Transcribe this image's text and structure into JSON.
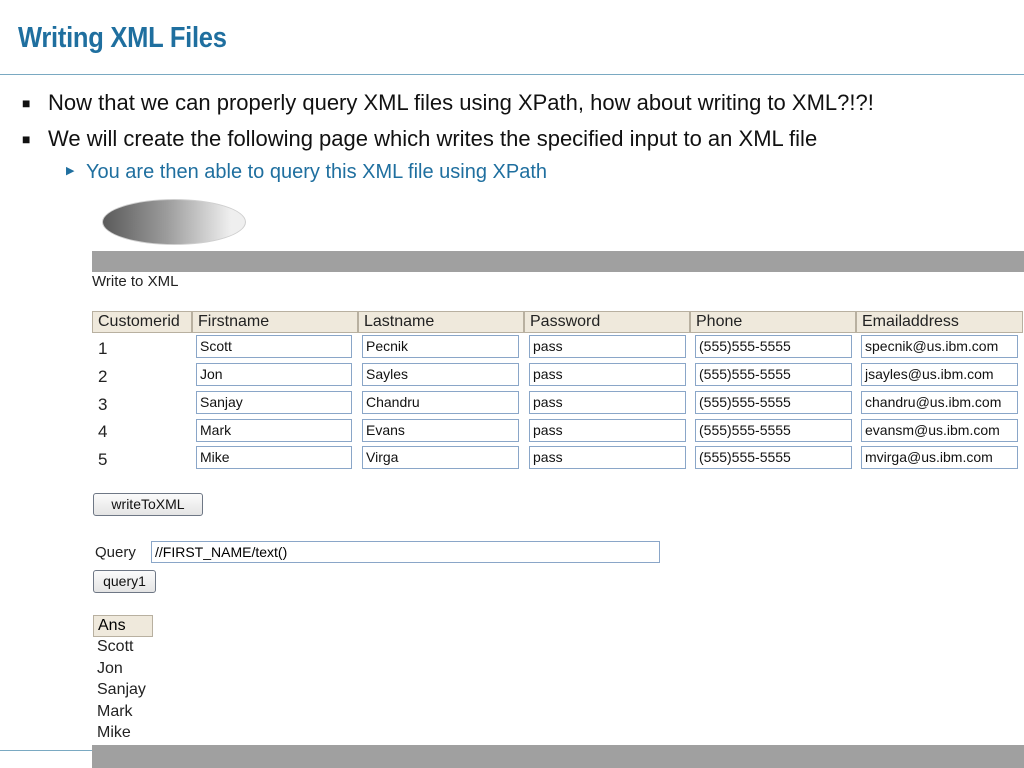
{
  "slide": {
    "title": "Writing XML Files",
    "bullets": [
      "Now that we can properly query XML files using XPath, how about writing to XML?!?!",
      "We will create the following page which writes the specified input to an XML file"
    ],
    "sub_bullet": "You are then able to query this XML file using XPath"
  },
  "app": {
    "page_label": "Write to XML",
    "columns": [
      "Customerid",
      "Firstname",
      "Lastname",
      "Password",
      "Phone",
      "Emailaddress"
    ],
    "rows": [
      {
        "id": "1",
        "first": "Scott",
        "last": "Pecnik",
        "password": "pass",
        "phone": "(555)555-5555",
        "email": "specnik@us.ibm.com"
      },
      {
        "id": "2",
        "first": "Jon",
        "last": "Sayles",
        "password": "pass",
        "phone": "(555)555-5555",
        "email": "jsayles@us.ibm.com"
      },
      {
        "id": "3",
        "first": "Sanjay",
        "last": "Chandru",
        "password": "pass",
        "phone": "(555)555-5555",
        "email": "chandru@us.ibm.com"
      },
      {
        "id": "4",
        "first": "Mark",
        "last": "Evans",
        "password": "pass",
        "phone": "(555)555-5555",
        "email": "evansm@us.ibm.com"
      },
      {
        "id": "5",
        "first": "Mike",
        "last": "Virga",
        "password": "pass",
        "phone": "(555)555-5555",
        "email": "mvirga@us.ibm.com"
      }
    ],
    "write_button": "writeToXML",
    "query_label": "Query",
    "query_value": "//FIRST_NAME/text()",
    "query_button": "query1",
    "answer_header": "Ans",
    "answers": [
      "Scott",
      "Jon",
      "Sanjay",
      "Mark",
      "Mike"
    ]
  }
}
